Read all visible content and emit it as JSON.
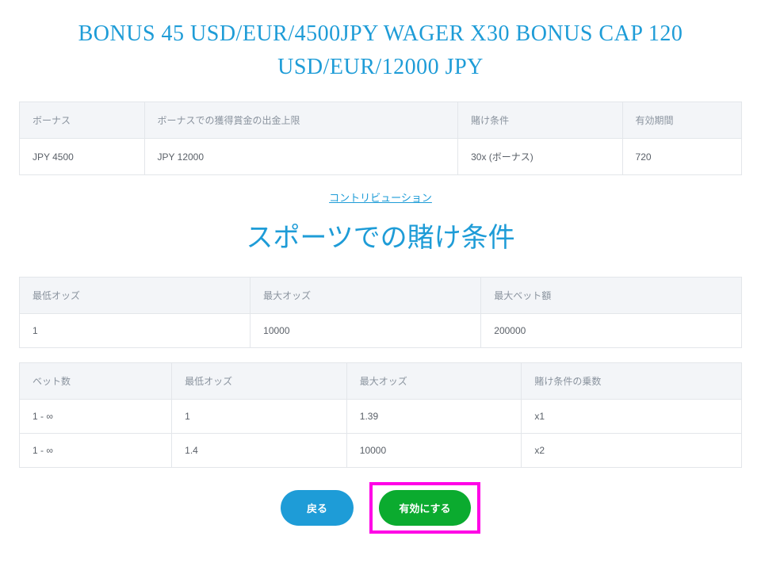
{
  "main_title": "BONUS 45 USD/EUR/4500JPY WAGER X30 BONUS CAP 120 USD/EUR/12000 JPY",
  "bonus_table": {
    "headers": [
      "ボーナス",
      "ボーナスでの獲得賞金の出金上限",
      "賭け条件",
      "有効期間"
    ],
    "row": [
      "JPY 4500",
      "JPY 12000",
      "30x (ボーナス)",
      "720"
    ]
  },
  "contribution_link": "コントリビューション",
  "section_title": "スポーツでの賭け条件",
  "sports_table": {
    "headers": [
      "最低オッズ",
      "最大オッズ",
      "最大ベット額"
    ],
    "row": [
      "1",
      "10000",
      "200000"
    ]
  },
  "multiplier_table": {
    "headers": [
      "ベット数",
      "最低オッズ",
      "最大オッズ",
      "賭け条件の乗数"
    ],
    "rows": [
      [
        "1 - ∞",
        "1",
        "1.39",
        "x1"
      ],
      [
        "1 - ∞",
        "1.4",
        "10000",
        "x2"
      ]
    ]
  },
  "buttons": {
    "back": "戻る",
    "activate": "有効にする"
  }
}
